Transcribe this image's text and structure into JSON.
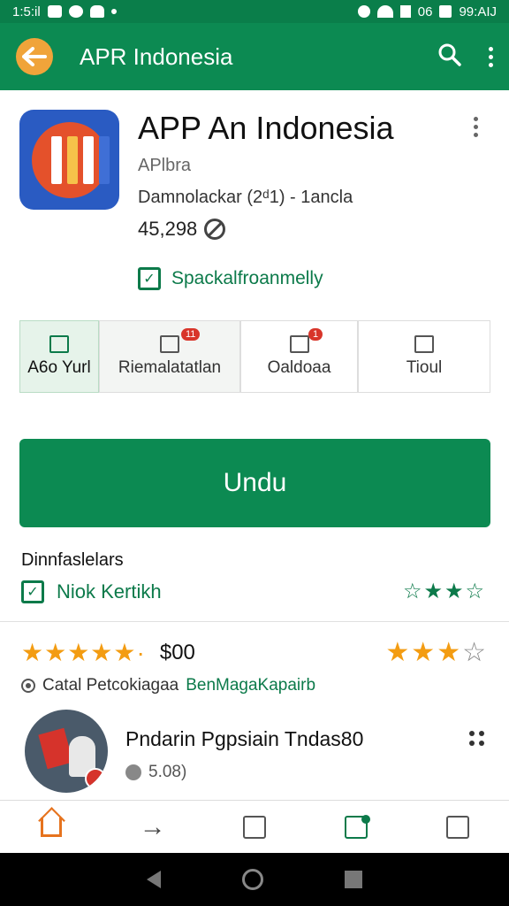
{
  "statusbar": {
    "time": "1:5:il",
    "right_label": "06",
    "clock": "99:AIJ"
  },
  "appbar": {
    "title": "APR Indonesia"
  },
  "app": {
    "title": "APP An Indonesia",
    "developer": "APlbra",
    "meta": "Damnolackar (2ᵈ1) - 1ancla",
    "downloads": "45,298",
    "verified": "Spackalfroanmelly"
  },
  "tabs": [
    {
      "label": "A6o Yurl",
      "icon": "app-icon",
      "badge": ""
    },
    {
      "label": "Riemalatatlan",
      "icon": "list-icon",
      "badge": "11"
    },
    {
      "label": "Oaldoaa",
      "icon": "list-icon",
      "badge": "1"
    },
    {
      "label": "Tioul",
      "icon": "chart-icon",
      "badge": ""
    }
  ],
  "install": {
    "label": "Undu"
  },
  "section": {
    "label": "Dinnfaslelars",
    "security_text": "Niok Kertikh",
    "security_stars": "☆★★☆"
  },
  "rating": {
    "stars": "★★★★★·",
    "price": "$00",
    "right_stars_full": "★★★",
    "right_stars_empty": "☆"
  },
  "policy": {
    "text": "Catal Petcokiagaa",
    "link": "BenMagaKapairb"
  },
  "review": {
    "name": "Pndarin Pgpsiain Tndas80",
    "meta": "5.08)"
  },
  "colors": {
    "brand_green": "#0c8a52",
    "accent_orange": "#f39c12"
  }
}
